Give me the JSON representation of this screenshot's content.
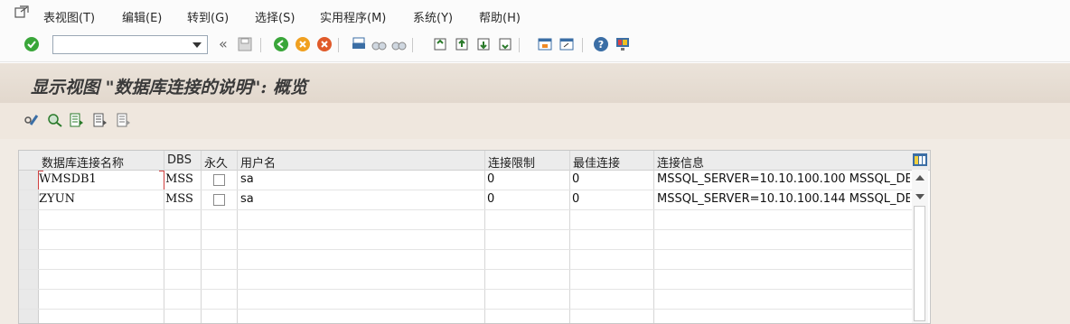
{
  "menu": {
    "items": [
      {
        "label": "表视图(T)"
      },
      {
        "label": "编辑(E)"
      },
      {
        "label": "转到(G)"
      },
      {
        "label": "选择(S)"
      },
      {
        "label": "实用程序(M)"
      },
      {
        "label": "系统(Y)"
      },
      {
        "label": "帮助(H)"
      }
    ]
  },
  "toolbar": {
    "command_field_value": "",
    "back_glyph": "«"
  },
  "title": "显示视图 \"数据库连接的说明\": 概览",
  "table": {
    "columns": [
      "数据库连接名称",
      "DBS",
      "永久",
      "用户名",
      "连接限制",
      "最佳连接",
      "连接信息"
    ],
    "rows": [
      {
        "name": "WMSDB1",
        "dbs": "MSS",
        "permanent": false,
        "user": "sa",
        "limit": "0",
        "optimal": "0",
        "info": "MSSQL_SERVER=10.10.100.100 MSSQL_DE"
      },
      {
        "name": "ZYUN",
        "dbs": "MSS",
        "permanent": false,
        "user": "sa",
        "limit": "0",
        "optimal": "0",
        "info": "MSSQL_SERVER=10.10.100.144 MSSQL_DE"
      }
    ]
  },
  "colors": {
    "title_bg": "#e6ddd2",
    "accent_green": "#3aa63a",
    "accent_orange": "#f08a24"
  }
}
